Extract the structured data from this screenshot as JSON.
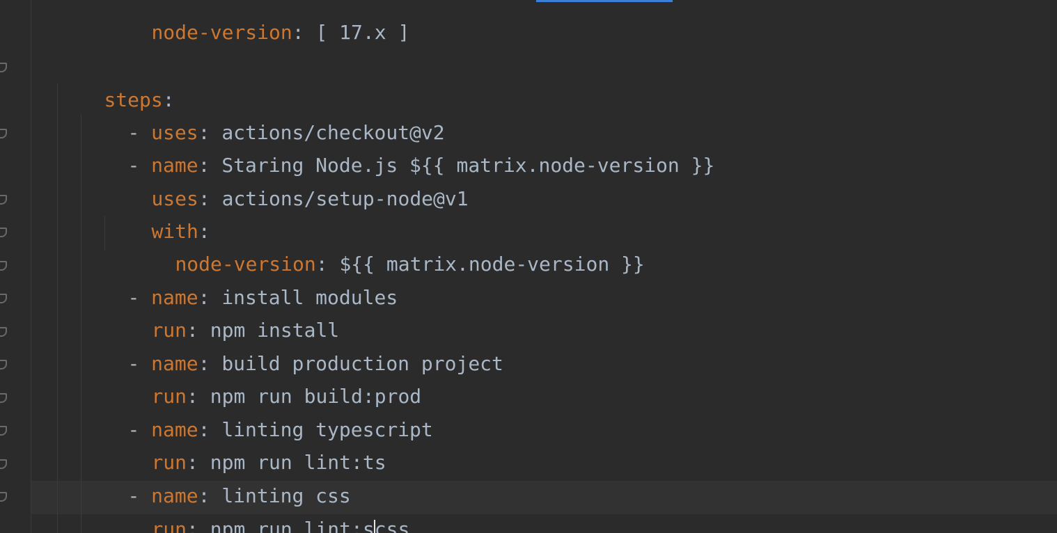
{
  "editor": {
    "language": "yaml",
    "colors": {
      "background": "#2b2b2b",
      "key": "#cc7832",
      "text": "#a9b7c6",
      "current_line": "#323232",
      "accent": "#3b7fd6"
    },
    "lines": [
      {
        "key": "node-version",
        "sep": ": ",
        "value": "[ 17.x ]"
      },
      {
        "key": "",
        "sep": "",
        "value": ""
      },
      {
        "key": "steps",
        "sep": ":",
        "value": ""
      },
      {
        "dash": "- ",
        "key": "uses",
        "sep": ": ",
        "value": "actions/checkout@v2"
      },
      {
        "dash": "- ",
        "key": "name",
        "sep": ": ",
        "value": "Staring Node.js ${{ matrix.node-version }}"
      },
      {
        "key": "uses",
        "sep": ": ",
        "value": "actions/setup-node@v1"
      },
      {
        "key": "with",
        "sep": ":",
        "value": ""
      },
      {
        "key": "node-version",
        "sep": ": ",
        "value": "${{ matrix.node-version }}"
      },
      {
        "dash": "- ",
        "key": "name",
        "sep": ": ",
        "value": "install modules"
      },
      {
        "key": "run",
        "sep": ": ",
        "value": "npm install"
      },
      {
        "dash": "- ",
        "key": "name",
        "sep": ": ",
        "value": "build production project"
      },
      {
        "key": "run",
        "sep": ": ",
        "value": "npm run build:prod"
      },
      {
        "dash": "- ",
        "key": "name",
        "sep": ": ",
        "value": "linting typescript"
      },
      {
        "key": "run",
        "sep": ": ",
        "value": "npm run lint:ts"
      },
      {
        "dash": "- ",
        "key": "name",
        "sep": ": ",
        "value": "linting css"
      },
      {
        "key": "run",
        "sep": ": ",
        "value_before_caret": "npm run lint:s",
        "value_after_caret": "css"
      }
    ]
  }
}
